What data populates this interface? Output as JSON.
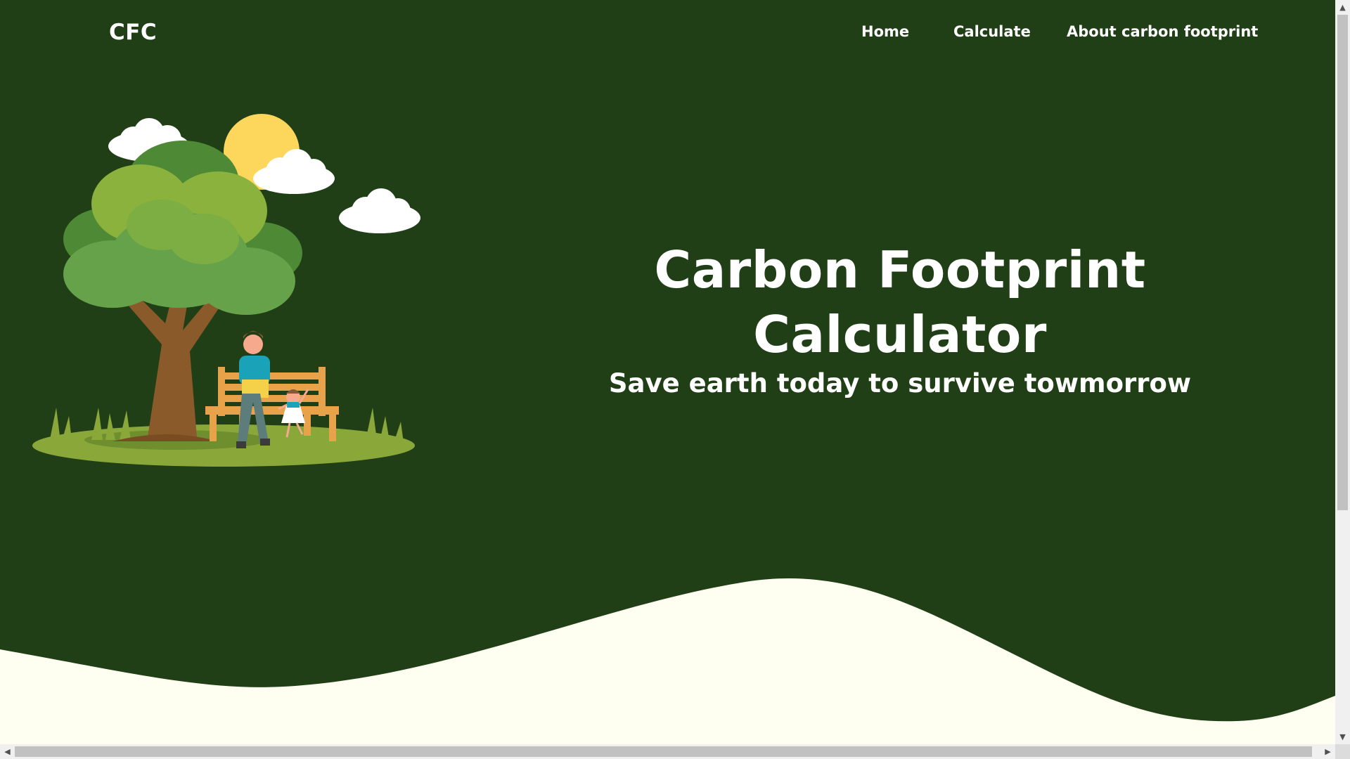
{
  "brand": {
    "logo_text": "CFC"
  },
  "nav": {
    "items": [
      {
        "label": "Home"
      },
      {
        "label": "Calculate"
      },
      {
        "label": "About carbon footprint"
      }
    ]
  },
  "hero": {
    "title": "Carbon Footprint Calculator",
    "subtitle": "Save earth today to survive towmorrow"
  },
  "illustration": {
    "icon": "park-bench-tree-illustration"
  },
  "colors": {
    "background": "#203f16",
    "wave": "#fefff0",
    "text": "#ffffff"
  }
}
